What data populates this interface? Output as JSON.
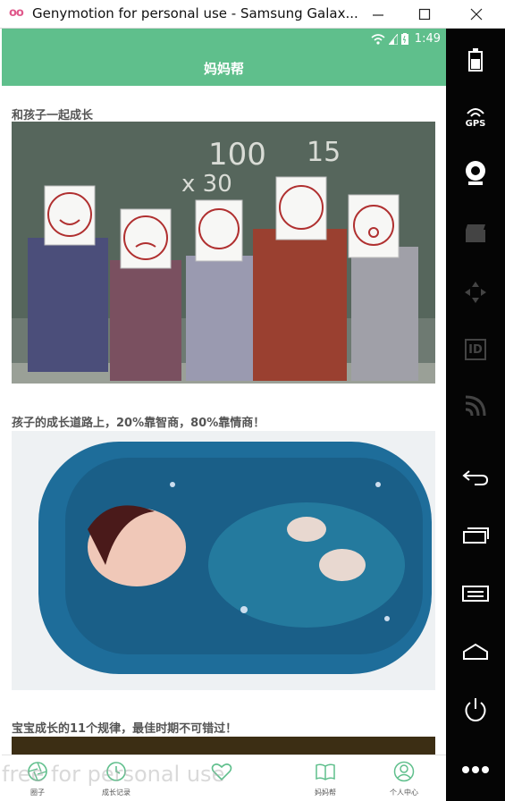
{
  "window": {
    "icon": "oo",
    "title": "Genymotion for personal use - Samsung Galax..."
  },
  "statusbar": {
    "time": "1:49"
  },
  "appbar": {
    "title": "妈妈帮"
  },
  "articles": [
    {
      "title": "和孩子一起成长",
      "image": "kids-with-face-drawings-photo"
    },
    {
      "title": "孩子的成长道路上，20%靠智商，80%靠情商！",
      "image": "child-in-blue-bath-photo"
    },
    {
      "title": "宝宝成长的11个规律，最佳时期不可错过！",
      "image": "article-image"
    }
  ],
  "bottomnav": {
    "items": [
      {
        "label": "圈子",
        "icon": "aperture-icon"
      },
      {
        "label": "成长记录",
        "icon": "clock-icon"
      },
      {
        "label": "",
        "icon": "heart-icon"
      },
      {
        "label": "妈妈帮",
        "icon": "book-icon"
      },
      {
        "label": "个人中心",
        "icon": "user-icon"
      }
    ]
  },
  "watermark": "free for personal use",
  "sidebar": {
    "gps_label": "GPS",
    "id_label": "ID",
    "tools": [
      "battery-icon",
      "gps-icon",
      "camera-icon",
      "media-icon",
      "dpad-icon",
      "id-icon",
      "cast-icon",
      "back-icon",
      "recent-apps-icon",
      "menu-icon",
      "home-icon",
      "power-icon",
      "more-icon"
    ]
  },
  "colors": {
    "accent": "#5fbf8c",
    "sidebar": "#050505"
  }
}
